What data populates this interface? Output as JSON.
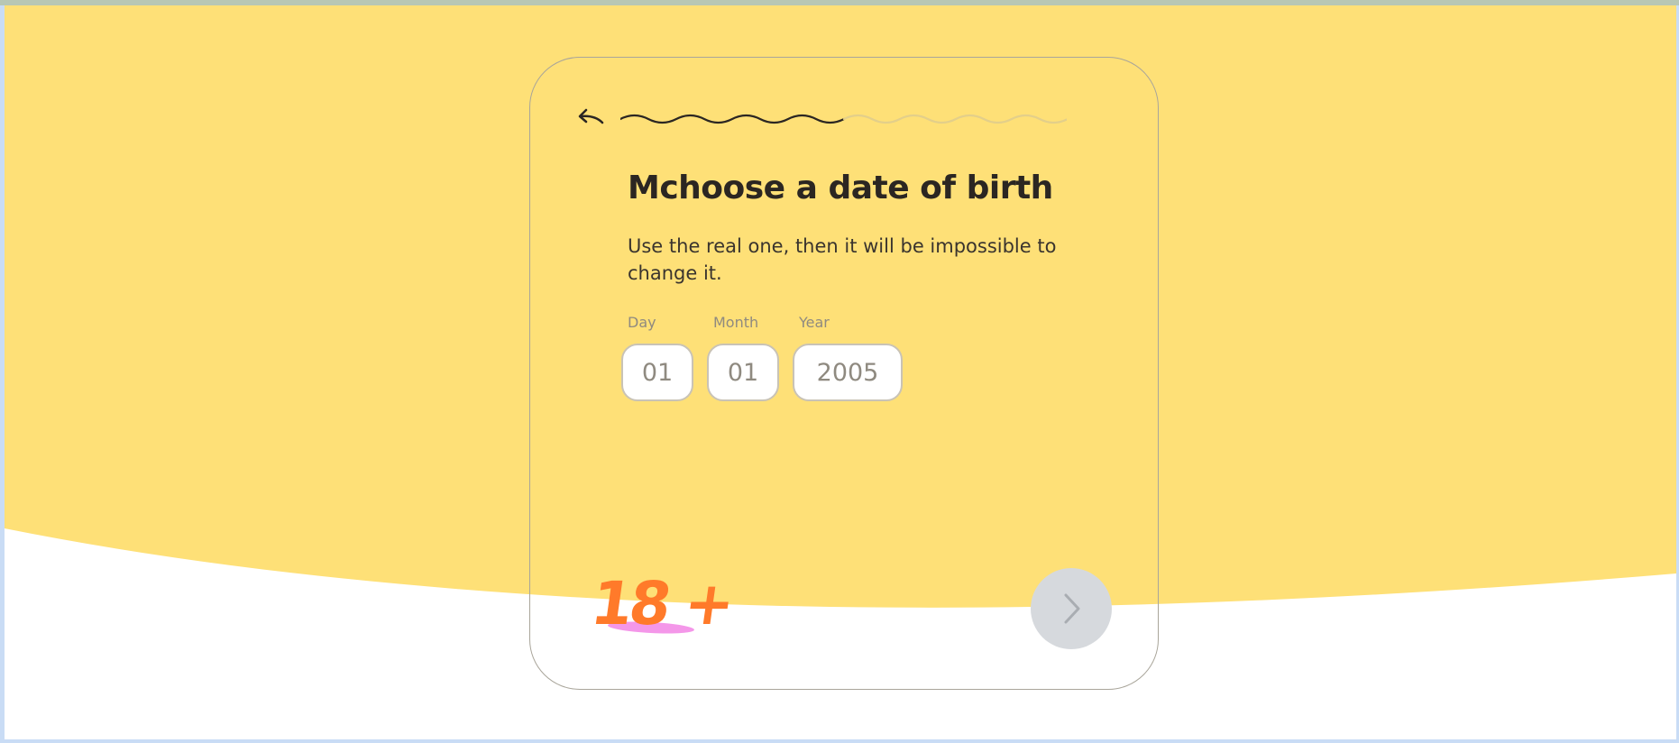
{
  "colors": {
    "background_yellow": "#fee077",
    "text_dark": "#2b2622",
    "muted": "#8f8a80",
    "age_badge_orange": "#ff7a2a",
    "age_badge_underline": "#f497e9",
    "next_button_bg": "#d6d9dd"
  },
  "header": {
    "back_icon": "back-arrow-icon",
    "progress": {
      "completed_fraction": 0.5
    }
  },
  "form": {
    "title": "Mchoose a date of birth",
    "subtitle": "Use the real one, then it will be impossible to change it.",
    "day": {
      "label": "Day",
      "value": "01"
    },
    "month": {
      "label": "Month",
      "value": "01"
    },
    "year": {
      "label": "Year",
      "value": "2005"
    }
  },
  "age_badge": {
    "text": "18 +"
  },
  "next_button": {
    "icon": "chevron-right-icon",
    "enabled": false
  }
}
